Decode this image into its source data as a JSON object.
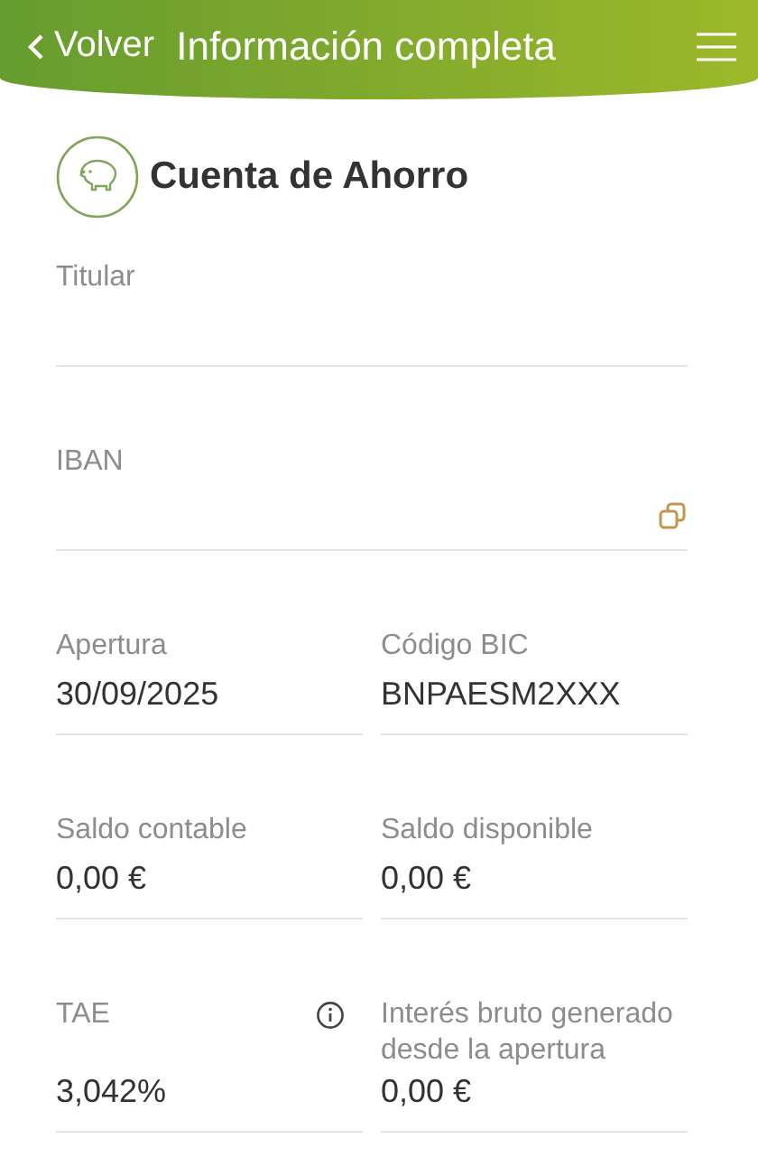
{
  "header": {
    "back_label": "Volver",
    "title": "Información completa"
  },
  "account": {
    "title": "Cuenta de Ahorro"
  },
  "fields": [
    {
      "kind": "full",
      "label": "Titular"
    },
    {
      "kind": "full",
      "label": "IBAN",
      "copyable": true
    },
    {
      "kind": "half",
      "label": "Apertura",
      "value": "30/09/2025"
    },
    {
      "kind": "half",
      "label": "Código BIC",
      "value": "BNPAESM2XXX"
    },
    {
      "kind": "half",
      "label": "Saldo contable",
      "value": "0,00 €"
    },
    {
      "kind": "half",
      "label": "Saldo disponible",
      "value": "0,00 €"
    },
    {
      "kind": "half",
      "label": "TAE",
      "value": "3,042%",
      "info": true
    },
    {
      "kind": "half",
      "label": "Interés bruto generado desde la apertura",
      "value": "0,00 €"
    }
  ]
}
